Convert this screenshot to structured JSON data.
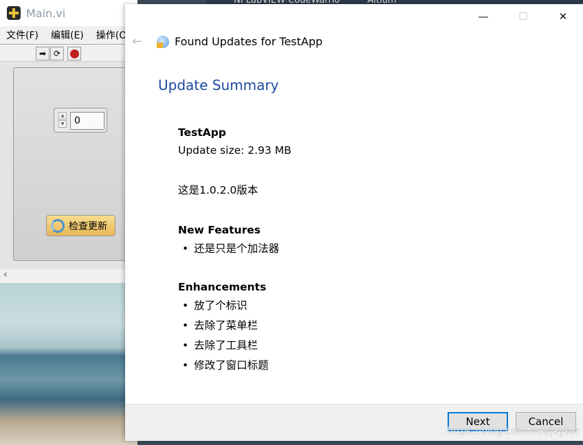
{
  "background": {
    "taskbar_fragments": [
      "NI LabVIEW CodeWarrio",
      "Altium"
    ],
    "watermark": "https://blog.csdn.net/jaysur"
  },
  "labview": {
    "title": "Main.vi",
    "menu": [
      "文件(F)",
      "编辑(E)",
      "操作(O"
    ],
    "toolbar": [
      "run-arrow-icon",
      "run-continuous-icon",
      "abort-icon"
    ],
    "numeric_value": "0",
    "check_button": "检查更新"
  },
  "dialog": {
    "header": "Found Updates for TestApp",
    "summary_title": "Update Summary",
    "app_name": "TestApp",
    "update_size": "Update size: 2.93 MB",
    "version_note": "这是1.0.2.0版本",
    "new_features_title": "New Features",
    "new_features": [
      "还是只是个加法器"
    ],
    "enhancements_title": "Enhancements",
    "enhancements": [
      "放了个标识",
      "去除了菜单栏",
      "去除了工具栏",
      "修改了窗口标题"
    ],
    "next": "Next",
    "cancel": "Cancel",
    "accent": "#0078d7",
    "title_color": "#1a4aa0"
  }
}
